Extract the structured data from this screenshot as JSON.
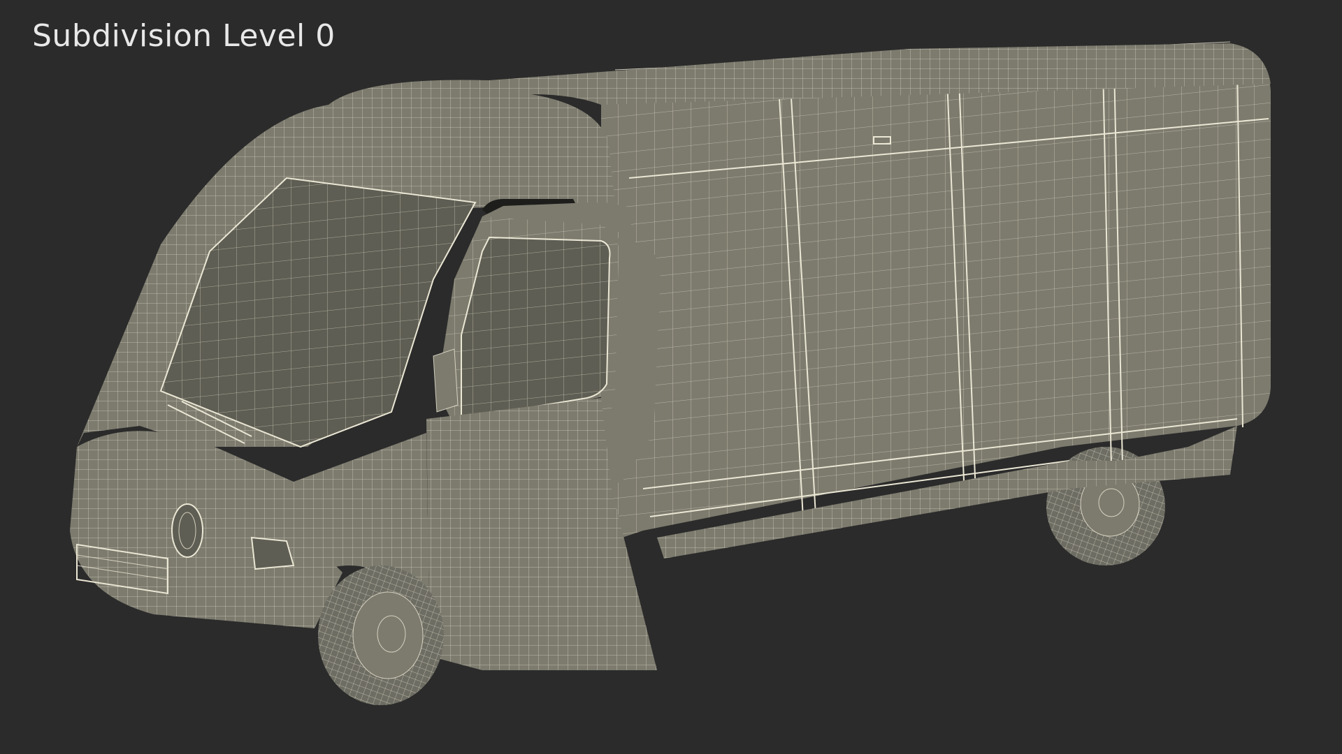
{
  "overlay": {
    "title": "Subdivision Level 0"
  },
  "scene": {
    "subject": "van-wireframe-render",
    "background_color": "#2b2b2b",
    "mesh_color": "#7d7b6e",
    "wire_color": "#e6e2cf"
  }
}
